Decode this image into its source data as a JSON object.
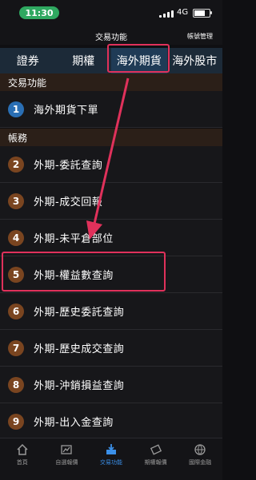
{
  "status": {
    "time": "11:30",
    "network": "4G"
  },
  "header": {
    "title": "交易功能",
    "account_mgmt": "帳號管理"
  },
  "tabs": [
    {
      "label": "證券",
      "active": false
    },
    {
      "label": "期權",
      "active": false
    },
    {
      "label": "海外期貨",
      "active": true
    },
    {
      "label": "海外股市",
      "active": false
    }
  ],
  "sections": [
    {
      "title": "交易功能"
    },
    {
      "title": "帳務"
    }
  ],
  "trade_items": [
    {
      "num": "1",
      "label": "海外期貨下單"
    }
  ],
  "account_items": [
    {
      "num": "2",
      "label": "外期-委託查詢"
    },
    {
      "num": "3",
      "label": "外期-成交回報"
    },
    {
      "num": "4",
      "label": "外期-未平倉部位"
    },
    {
      "num": "5",
      "label": "外期-權益數查詢"
    },
    {
      "num": "6",
      "label": "外期-歷史委託查詢"
    },
    {
      "num": "7",
      "label": "外期-歷史成交查詢"
    },
    {
      "num": "8",
      "label": "外期-沖銷損益查詢"
    },
    {
      "num": "9",
      "label": "外期-出入金查詢"
    }
  ],
  "bottom_nav": [
    {
      "label": "首頁",
      "icon": "home-icon",
      "active": false
    },
    {
      "label": "自選報價",
      "icon": "stock-quote-icon",
      "active": false
    },
    {
      "label": "交易功能",
      "icon": "trade-icon",
      "active": true
    },
    {
      "label": "期權報價",
      "icon": "futures-quote-icon",
      "active": false
    },
    {
      "label": "國際金融",
      "icon": "globe-icon",
      "active": false
    }
  ],
  "colors": {
    "highlight": "#e0315b",
    "accent": "#3a8fe8",
    "active_tab": "#1f3b56"
  }
}
